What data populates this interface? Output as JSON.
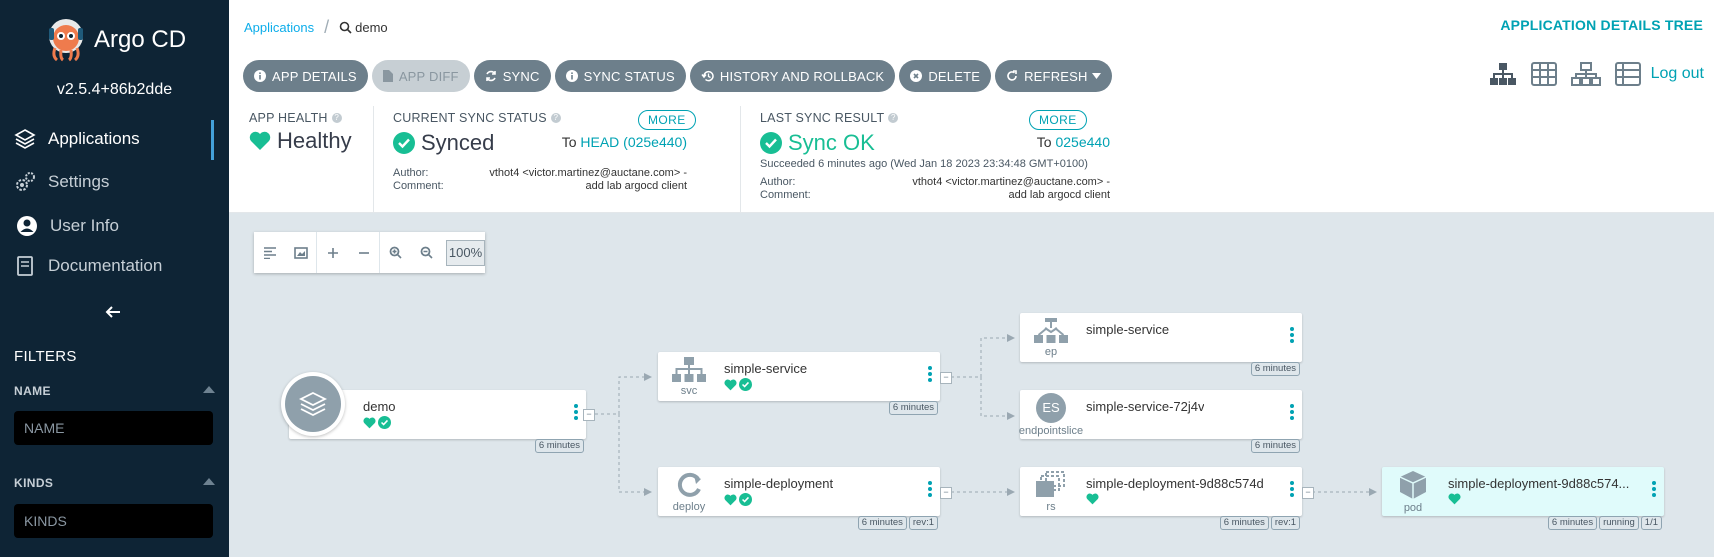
{
  "sidebar": {
    "brand": "Argo CD",
    "version": "v2.5.4+86b2dde",
    "items": [
      {
        "label": "Applications",
        "icon": "layers-icon"
      },
      {
        "label": "Settings",
        "icon": "gears-icon"
      },
      {
        "label": "User Info",
        "icon": "user-circle-icon"
      },
      {
        "label": "Documentation",
        "icon": "book-icon"
      }
    ],
    "filters_title": "FILTERS",
    "filters": [
      {
        "label": "NAME",
        "placeholder": "NAME"
      },
      {
        "label": "KINDS",
        "placeholder": "KINDS"
      }
    ]
  },
  "header": {
    "breadcrumb_root": "Applications",
    "breadcrumb_current": "demo",
    "view_title": "APPLICATION DETAILS TREE",
    "logout": "Log out"
  },
  "toolbar": {
    "buttons": [
      {
        "label": "APP DETAILS",
        "icon": "info-icon"
      },
      {
        "label": "APP DIFF",
        "icon": "file-icon",
        "disabled": true
      },
      {
        "label": "SYNC",
        "icon": "sync-icon"
      },
      {
        "label": "SYNC STATUS",
        "icon": "info-icon"
      },
      {
        "label": "HISTORY AND ROLLBACK",
        "icon": "history-icon"
      },
      {
        "label": "DELETE",
        "icon": "times-circle-icon"
      },
      {
        "label": "REFRESH",
        "icon": "redo-icon"
      }
    ]
  },
  "status": {
    "health": {
      "label": "APP HEALTH",
      "value": "Healthy"
    },
    "sync": {
      "label": "CURRENT SYNC STATUS",
      "more": "MORE",
      "value": "Synced",
      "to_prefix": "To",
      "to_value": "HEAD (025e440)",
      "author_label": "Author:",
      "comment_label": "Comment:",
      "author_value": "vthot4 <victor.martinez@auctane.com> -",
      "comment_value": "add lab argocd client"
    },
    "last_sync": {
      "label": "LAST SYNC RESULT",
      "more": "MORE",
      "value": "Sync OK",
      "to_prefix": "To",
      "to_value": "025e440",
      "succeeded": "Succeeded 6 minutes ago (Wed Jan 18 2023 23:34:48 GMT+0100)",
      "author_label": "Author:",
      "comment_label": "Comment:",
      "author_value": "vthot4 <victor.martinez@auctane.com> -",
      "comment_value": "add lab argocd client"
    }
  },
  "canvas": {
    "zoom": "100%",
    "colors": {
      "healthy": "#18be94",
      "synced": "#18be94",
      "accent": "#00a2b3"
    },
    "nodes": {
      "app": {
        "name": "demo",
        "age": "6 minutes"
      },
      "svc": {
        "name": "simple-service",
        "kind": "svc",
        "age": "6 minutes"
      },
      "deploy": {
        "name": "simple-deployment",
        "kind": "deploy",
        "age": "6 minutes",
        "rev": "rev:1"
      },
      "ep": {
        "name": "simple-service",
        "kind": "ep",
        "age": "6 minutes"
      },
      "es": {
        "name": "simple-service-72j4v",
        "kind": "endpointslice",
        "badge": "ES",
        "age": "6 minutes"
      },
      "rs": {
        "name": "simple-deployment-9d88c574d",
        "kind": "rs",
        "age": "6 minutes",
        "rev": "rev:1"
      },
      "pod": {
        "name": "simple-deployment-9d88c574...",
        "kind": "pod",
        "age": "6 minutes",
        "state": "running",
        "ready": "1/1"
      }
    }
  }
}
